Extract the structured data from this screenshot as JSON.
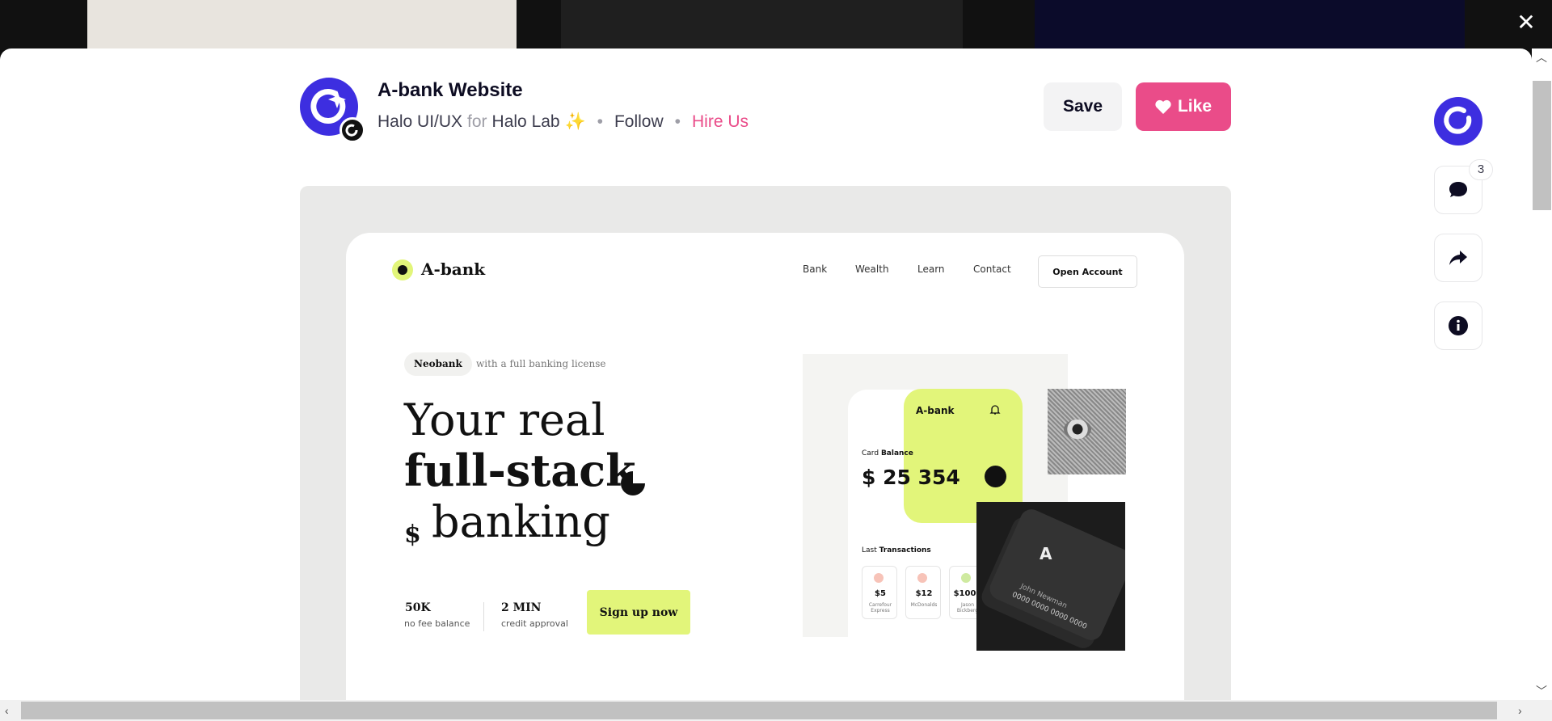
{
  "shot": {
    "title": "A-bank Website",
    "designer": "Halo UI/UX",
    "for_word": "for",
    "team": "Halo Lab ✨",
    "follow": "Follow",
    "hire": "Hire Us",
    "separator": "•"
  },
  "actions": {
    "save": "Save",
    "like": "Like",
    "comments_count": "3"
  },
  "preview": {
    "brand": "A-bank",
    "nav": [
      "Bank",
      "Wealth",
      "Learn",
      "Contact"
    ],
    "open_account": "Open Account",
    "pill": "Neobank",
    "pill_note": "with a full banking license",
    "hero_line1": "Your real",
    "hero_line2": "full-stack",
    "hero_line3": "banking",
    "stat1_value": "50K",
    "stat1_label": "no fee balance",
    "stat2_value": "2 MIN",
    "stat2_label": "credit approval",
    "signup": "Sign up now",
    "app_brand": "A-bank",
    "card_balance_label": "Card",
    "card_balance_bold": "Balance",
    "balance": "$ 25 354",
    "last_tx_label": "Last",
    "last_tx_bold": "Transactions",
    "transactions": [
      {
        "amount": "$5",
        "name": "Carrefour Express",
        "color": "#f7c3b8"
      },
      {
        "amount": "$12",
        "name": "McDonalds",
        "color": "#f7c3b8"
      },
      {
        "amount": "$1000",
        "name": "Jason Bickberg",
        "color": "#cfeaa0"
      }
    ],
    "card_holder": "John Newman",
    "card_number": "0000 0000 0000 0000"
  },
  "colors": {
    "accent_pink": "#ea4c89",
    "brand_purple": "#3d2ee0",
    "lime": "#e2f57a"
  }
}
